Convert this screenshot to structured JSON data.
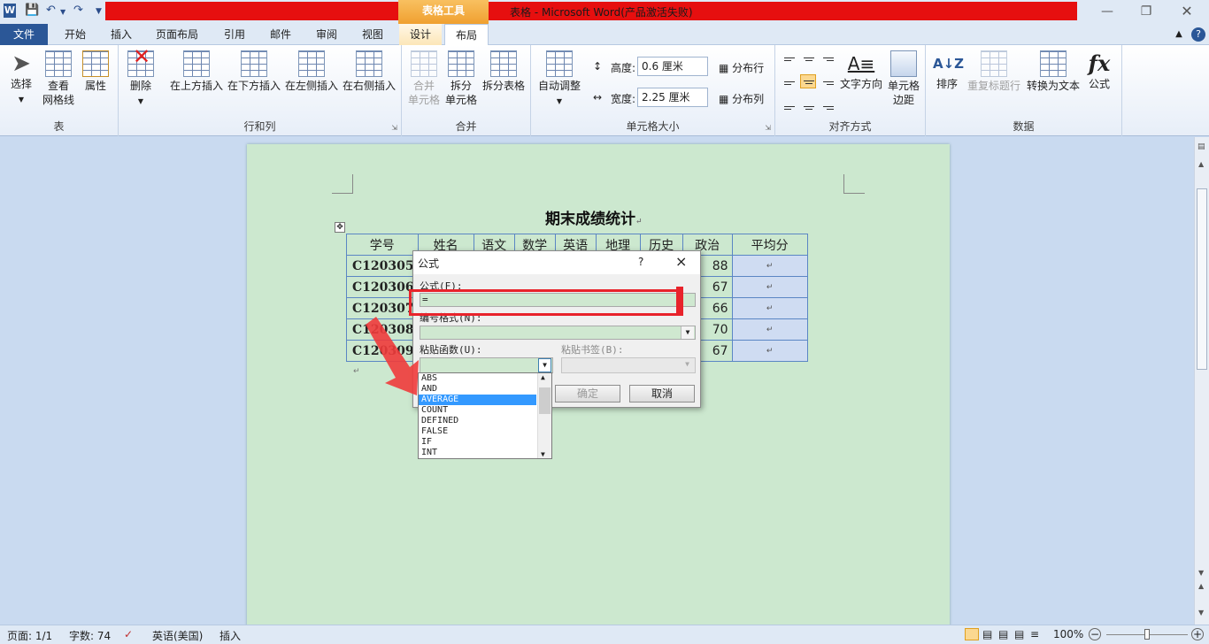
{
  "titlebar": {
    "table_tools": "表格工具",
    "title": "表格 - Microsoft Word(产品激活失败)",
    "app_icon": "W"
  },
  "tabs": {
    "file": "文件",
    "home": "开始",
    "insert": "插入",
    "page_layout": "页面布局",
    "references": "引用",
    "mailings": "邮件",
    "review": "审阅",
    "view": "视图",
    "design": "设计",
    "layout": "布局"
  },
  "ribbon": {
    "table": {
      "select": "选择",
      "view_gridlines_1": "查看",
      "view_gridlines_2": "网格线",
      "properties": "属性",
      "label": "表"
    },
    "rows_cols": {
      "delete": "删除",
      "insert_above": "在上方插入",
      "insert_below": "在下方插入",
      "insert_left": "在左侧插入",
      "insert_right": "在右侧插入",
      "label": "行和列"
    },
    "merge": {
      "merge_cells_1": "合并",
      "merge_cells_2": "单元格",
      "split_cells_1": "拆分",
      "split_cells_2": "单元格",
      "split_table": "拆分表格",
      "label": "合并"
    },
    "cell_size": {
      "autofit": "自动调整",
      "height_label": "高度:",
      "height_value": "0.6 厘米",
      "width_label": "宽度:",
      "width_value": "2.25 厘米",
      "distribute_rows": "分布行",
      "distribute_cols": "分布列",
      "label": "单元格大小"
    },
    "alignment": {
      "text_direction": "文字方向",
      "cell_margins_1": "单元格",
      "cell_margins_2": "边距",
      "label": "对齐方式"
    },
    "data": {
      "sort": "排序",
      "repeat_header": "重复标题行",
      "convert_to_text": "转换为文本",
      "formula": "公式",
      "label": "数据"
    }
  },
  "document": {
    "title": "期末成绩统计",
    "headers": [
      "学号",
      "姓名",
      "语文",
      "数学",
      "英语",
      "地理",
      "历史",
      "政治",
      "平均分"
    ],
    "rows": [
      {
        "id": "C120305",
        "politics": "88"
      },
      {
        "id": "C120306",
        "politics": "67"
      },
      {
        "id": "C120307",
        "politics": "66"
      },
      {
        "id": "C120308",
        "politics": "70"
      },
      {
        "id": "C120309",
        "politics": "67"
      }
    ]
  },
  "dialog": {
    "title": "公式",
    "help": "?",
    "close": "×",
    "formula_label": "公式(F):",
    "formula_value": "=",
    "number_format_label": "编号格式(N):",
    "paste_function_label": "粘贴函数(U):",
    "paste_bookmark_label": "粘贴书签(B):",
    "ok": "确定",
    "cancel": "取消",
    "functions": [
      "ABS",
      "AND",
      "AVERAGE",
      "COUNT",
      "DEFINED",
      "FALSE",
      "IF",
      "INT"
    ],
    "selected_function": "AVERAGE"
  },
  "statusbar": {
    "page": "页面: 1/1",
    "words": "字数: 74",
    "language": "英语(美国)",
    "mode": "插入",
    "zoom": "100%"
  },
  "colors": {
    "title_red": "#e60f0f",
    "file_tab": "#2b5797",
    "page_bg": "#cce8cf",
    "highlight": "#3399ff",
    "annotation": "#e8232b"
  }
}
